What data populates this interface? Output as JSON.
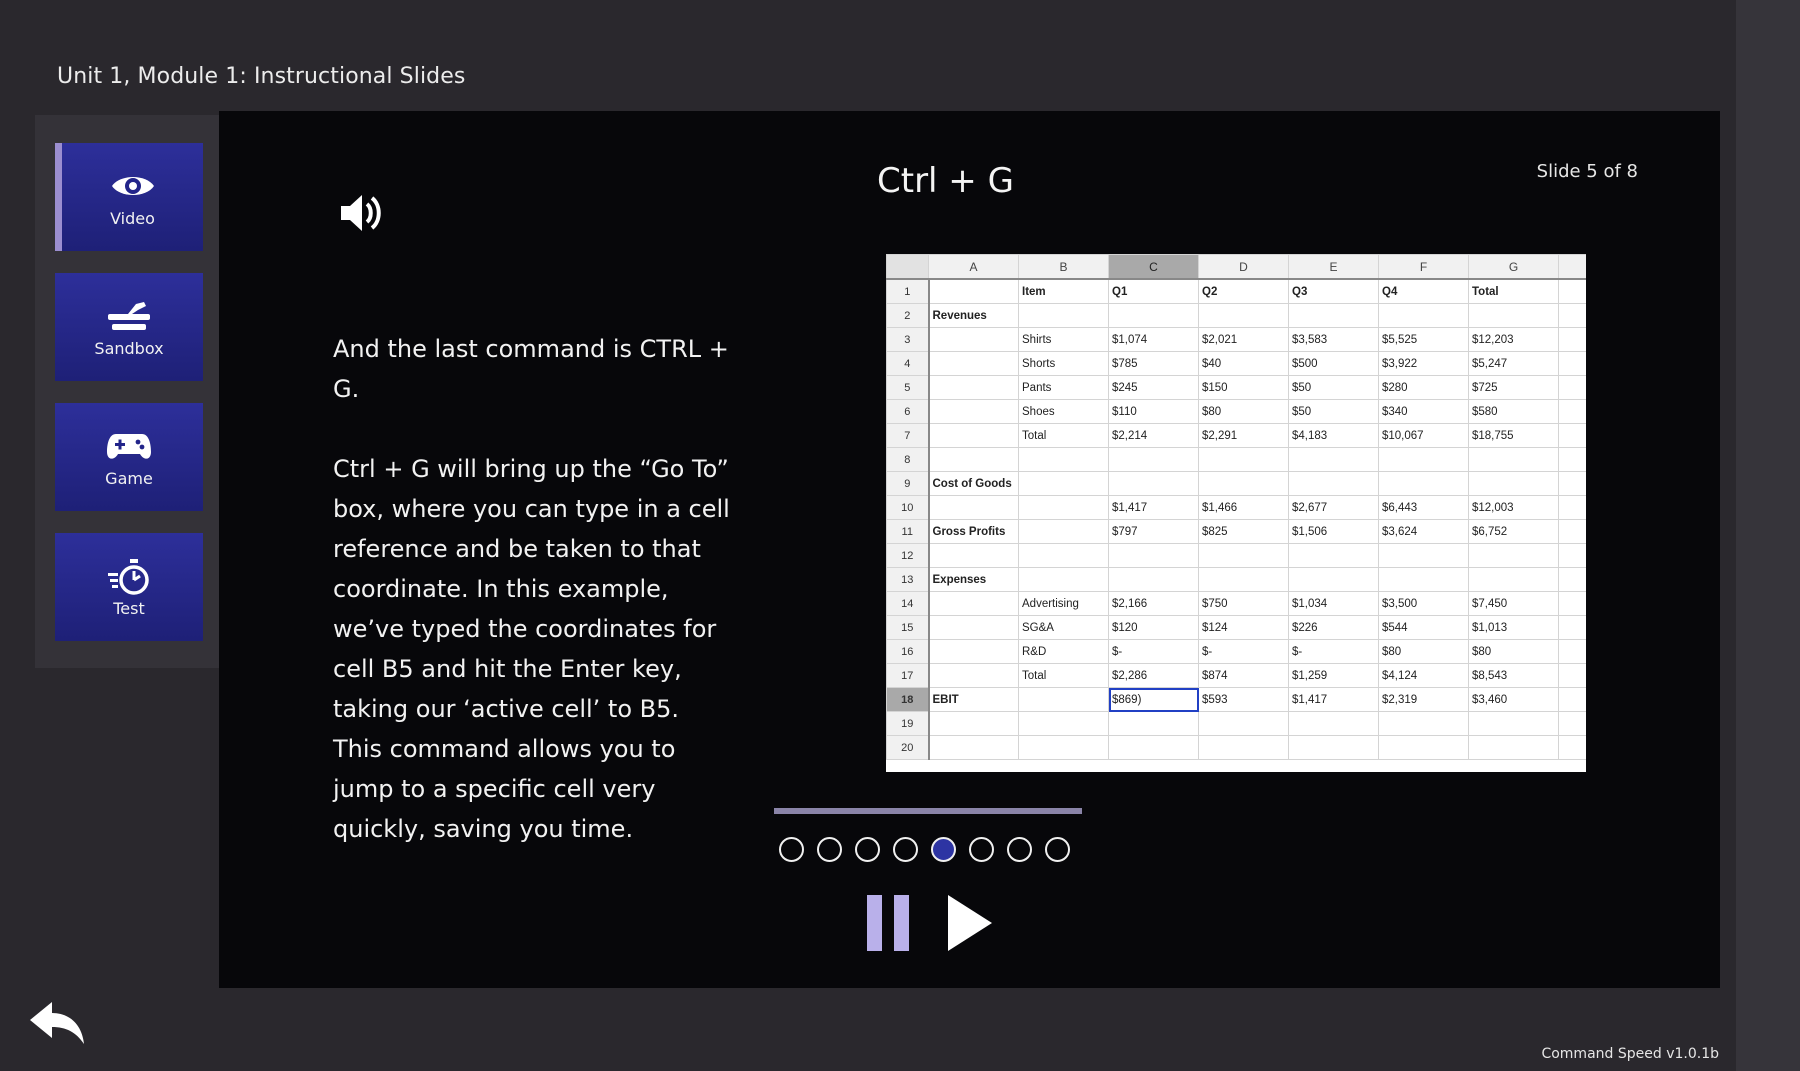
{
  "header": {
    "title": "Unit 1, Module 1: Instructional Slides"
  },
  "sidebar": {
    "items": [
      {
        "label": "Video",
        "icon": "eye-icon",
        "active": true
      },
      {
        "label": "Sandbox",
        "icon": "sandbox-tool-icon",
        "active": false
      },
      {
        "label": "Game",
        "icon": "gamepad-icon",
        "active": false
      },
      {
        "label": "Test",
        "icon": "stopwatch-icon",
        "active": false
      }
    ]
  },
  "slide": {
    "title": "Ctrl + G",
    "counter": "Slide 5 of 8",
    "paragraphs": [
      "And the last command is CTRL + G.",
      "Ctrl + G will bring up the “Go To” box, where you can type in a cell reference and be taken to that coordinate. In this example, we’ve typed the coordinates for cell B5 and hit the Enter key, taking our ‘active cell’ to B5. This command allows you to jump to a specific cell very quickly, saving you time."
    ]
  },
  "spreadsheet": {
    "columns": [
      "",
      "A",
      "B",
      "C",
      "D",
      "E",
      "F",
      "G",
      ""
    ],
    "selected_column": "C",
    "selected_row": "18",
    "rows": [
      [
        "1",
        "",
        "Item",
        "Q1",
        "Q2",
        "Q3",
        "Q4",
        "Total",
        ""
      ],
      [
        "2",
        "Revenues",
        "",
        "",
        "",
        "",
        "",
        "",
        ""
      ],
      [
        "3",
        "",
        "Shirts",
        "$1,074",
        "$2,021",
        "$3,583",
        "$5,525",
        "$12,203",
        ""
      ],
      [
        "4",
        "",
        "Shorts",
        "$785",
        "$40",
        "$500",
        "$3,922",
        "$5,247",
        ""
      ],
      [
        "5",
        "",
        "Pants",
        "$245",
        "$150",
        "$50",
        "$280",
        "$725",
        ""
      ],
      [
        "6",
        "",
        "Shoes",
        "$110",
        "$80",
        "$50",
        "$340",
        "$580",
        ""
      ],
      [
        "7",
        "",
        "Total",
        "$2,214",
        "$2,291",
        "$4,183",
        "$10,067",
        "$18,755",
        ""
      ],
      [
        "8",
        "",
        "",
        "",
        "",
        "",
        "",
        "",
        ""
      ],
      [
        "9",
        "Cost of Goods",
        "",
        "",
        "",
        "",
        "",
        "",
        ""
      ],
      [
        "10",
        "",
        "",
        "$1,417",
        "$1,466",
        "$2,677",
        "$6,443",
        "$12,003",
        ""
      ],
      [
        "11",
        "Gross Profits",
        "",
        "$797",
        "$825",
        "$1,506",
        "$3,624",
        "$6,752",
        ""
      ],
      [
        "12",
        "",
        "",
        "",
        "",
        "",
        "",
        "",
        ""
      ],
      [
        "13",
        "Expenses",
        "",
        "",
        "",
        "",
        "",
        "",
        ""
      ],
      [
        "14",
        "",
        "Advertising",
        "$2,166",
        "$750",
        "$1,034",
        "$3,500",
        "$7,450",
        ""
      ],
      [
        "15",
        "",
        "SG&A",
        "$120",
        "$124",
        "$226",
        "$544",
        "$1,013",
        ""
      ],
      [
        "16",
        "",
        "R&D",
        "$-",
        "$-",
        "$-",
        "$80",
        "$80",
        ""
      ],
      [
        "17",
        "",
        "Total",
        "$2,286",
        "$874",
        "$1,259",
        "$4,124",
        "$8,543",
        ""
      ],
      [
        "18",
        "EBIT",
        "",
        "$869)",
        "$593",
        "$1,417",
        "$2,319",
        "$3,460",
        ""
      ],
      [
        "19",
        "",
        "",
        "",
        "",
        "",
        "",
        "",
        ""
      ],
      [
        "20",
        "",
        "",
        "",
        "",
        "",
        "",
        "",
        ""
      ]
    ],
    "bold_labels": [
      "Revenues",
      "Cost of Goods",
      "Gross Profits",
      "Expenses",
      "EBIT",
      "Item",
      "Q1",
      "Q2",
      "Q3",
      "Q4",
      "Total"
    ]
  },
  "player": {
    "progress": 0.3,
    "total_slides": 8,
    "current_slide": 5,
    "pause_icon": "pause-icon",
    "play_icon": "play-icon"
  },
  "footer": {
    "version": "Command Speed v1.0.1b",
    "back_icon": "back-arrow-icon"
  },
  "colors": {
    "accent": "#2d34a3",
    "pause": "#b9b0ea",
    "background": "#2a282d",
    "stage": "#07070a"
  }
}
